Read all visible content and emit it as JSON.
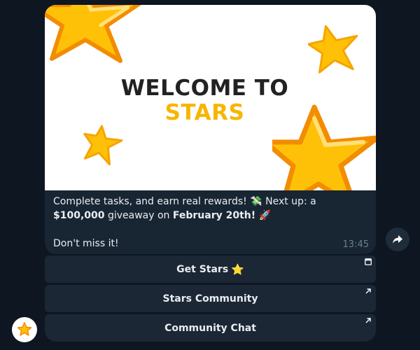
{
  "banner": {
    "line1": "WELCOME TO",
    "line2": "STARS"
  },
  "message": {
    "part1": "Complete tasks, and earn real rewards! ",
    "emoji1": "💸",
    "part2": " Next up: a ",
    "amount": "$100,000",
    "part3": " giveaway on ",
    "date": "February 20th!",
    "emoji2": "🚀",
    "line2": "Don't miss it!",
    "time": "13:45"
  },
  "buttons": [
    {
      "label": "Get Stars",
      "emoji": "⭐",
      "corner_icon": "window-icon"
    },
    {
      "label": "Stars Community",
      "corner_icon": "external-link-icon"
    },
    {
      "label": "Community Chat",
      "corner_icon": "external-link-icon"
    }
  ],
  "colors": {
    "background": "#0e1621",
    "bubble": "#182533",
    "button": "#1b2735",
    "accent": "#f8b500",
    "star": "#ffc107"
  }
}
